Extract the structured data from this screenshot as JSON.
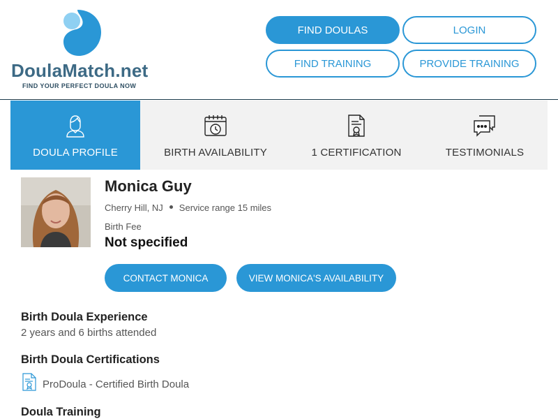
{
  "colors": {
    "accent": "#2a97d6",
    "logo_dark": "#3d6a85",
    "tab_bg": "#f2f2f2"
  },
  "logo": {
    "name": "DoulaMatch.net",
    "tagline": "FIND YOUR PERFECT DOULA NOW"
  },
  "nav": {
    "find_doulas": "FIND DOULAS",
    "login": "LOGIN",
    "find_training": "FIND TRAINING",
    "provide_training": "PROVIDE TRAINING"
  },
  "tabs": [
    {
      "label": "DOULA PROFILE",
      "icon": "person-icon",
      "active": true
    },
    {
      "label": "BIRTH AVAILABILITY",
      "icon": "calendar-clock-icon",
      "active": false
    },
    {
      "label": "1 CERTIFICATION",
      "icon": "certificate-icon",
      "active": false
    },
    {
      "label": "TESTIMONIALS",
      "icon": "chat-bubbles-icon",
      "active": false
    }
  ],
  "profile": {
    "name": "Monica Guy",
    "location": "Cherry Hill, NJ",
    "service_range": "Service range 15 miles",
    "fee_label": "Birth Fee",
    "fee_value": "Not specified",
    "contact_button": "CONTACT MONICA",
    "availability_button": "VIEW MONICA'S AVAILABILITY"
  },
  "sections": {
    "experience_title": "Birth Doula Experience",
    "experience_text": "2 years and 6 births attended",
    "certifications_title": "Birth Doula Certifications",
    "certification_item": "ProDoula - Certified Birth Doula",
    "training_title": "Doula Training"
  }
}
